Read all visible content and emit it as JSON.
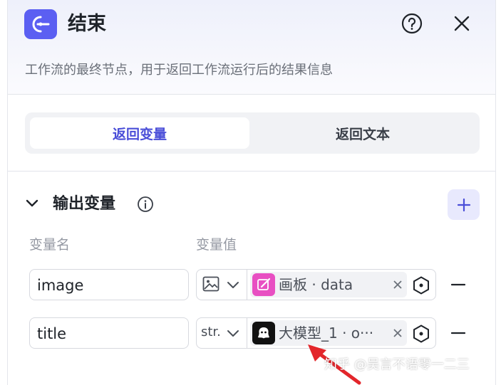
{
  "node": {
    "title": "结束",
    "description": "工作流的最终节点，用于返回工作流运行后的结果信息",
    "icon": "end-node-icon",
    "accent_color": "#5b5ff2"
  },
  "header": {
    "help_icon": "help-circle-icon",
    "close_icon": "close-icon"
  },
  "return_tabs": [
    {
      "label": "返回变量",
      "active": true
    },
    {
      "label": "返回文本",
      "active": false
    }
  ],
  "output_section": {
    "title": "输出变量",
    "info_icon": "info-icon",
    "add_icon": "plus-icon",
    "columns": {
      "name": "变量名",
      "value": "变量值"
    },
    "rows": [
      {
        "name": "image",
        "type_icon": "image-type-icon",
        "type_label": "",
        "ref_icon": "canvas-node-icon",
        "ref_icon_color": "#e84fc2",
        "ref_text": "画板 · data"
      },
      {
        "name": "title",
        "type_icon": "",
        "type_label": "str.",
        "ref_icon": "llm-node-icon",
        "ref_icon_color": "#111111",
        "ref_text": "大模型_1 · o···"
      }
    ]
  },
  "watermark": "知乎 @吴言不语零一二三"
}
